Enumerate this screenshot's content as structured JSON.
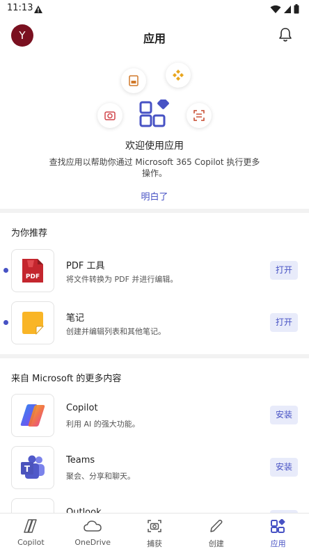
{
  "status_bar": {
    "time": "11:13"
  },
  "header": {
    "avatar_initial": "Y",
    "title": "应用"
  },
  "hero": {
    "title": "欢迎使用应用",
    "description": "查找应用以帮助你通过 Microsoft 365 Copilot 执行更多操作。",
    "got_it": "明白了"
  },
  "recommended": {
    "title": "为你推荐",
    "items": [
      {
        "name": "PDF 工具",
        "description": "将文件转换为 PDF 并进行编辑。",
        "action": "打开",
        "icon": "pdf-icon",
        "badge_text": "PDF"
      },
      {
        "name": "笔记",
        "description": "创建并编辑列表和其他笔记。",
        "action": "打开",
        "icon": "notes-icon"
      }
    ]
  },
  "more": {
    "title": "来自 Microsoft 的更多内容",
    "items": [
      {
        "name": "Copilot",
        "description": "利用 AI 的强大功能。",
        "action": "安装",
        "icon": "copilot-icon"
      },
      {
        "name": "Teams",
        "description": "聚会、分享和聊天。",
        "action": "安装",
        "icon": "teams-icon",
        "badge_text": "T"
      },
      {
        "name": "Outlook",
        "description": "",
        "action": "安装",
        "icon": "outlook-icon"
      }
    ]
  },
  "bottom_nav": [
    {
      "label": "Copilot",
      "icon": "copilot-nav-icon",
      "active": false
    },
    {
      "label": "OneDrive",
      "icon": "cloud-icon",
      "active": false
    },
    {
      "label": "捕获",
      "icon": "camera-icon",
      "active": false
    },
    {
      "label": "创建",
      "icon": "pen-icon",
      "active": false
    },
    {
      "label": "应用",
      "icon": "apps-icon",
      "active": true
    }
  ],
  "colors": {
    "accent": "#4752c4",
    "avatar": "#7a1020",
    "pdf_red": "#c4262e",
    "notes_yellow": "#f9b526",
    "teams_purple": "#5059c9"
  }
}
